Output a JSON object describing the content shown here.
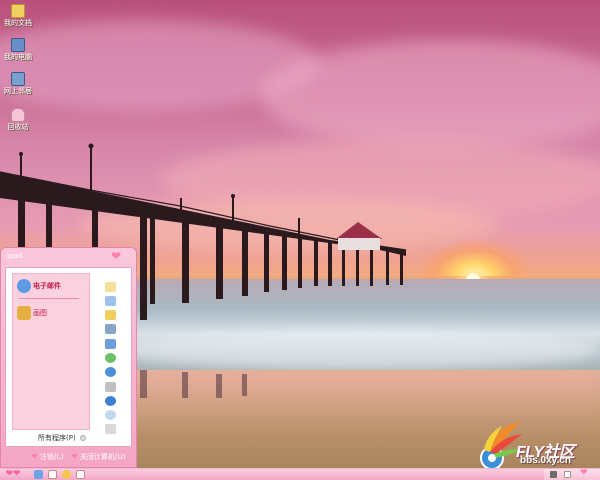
{
  "desktop_icons": [
    {
      "label": "我的文档",
      "icon": "folder-icon",
      "color": "#f0d060"
    },
    {
      "label": "我的电脑",
      "icon": "computer-icon",
      "color": "#6a8fc8"
    },
    {
      "label": "网上邻居",
      "icon": "network-icon",
      "color": "#7aa0d0"
    },
    {
      "label": "回收站",
      "icon": "recycle-bin-icon",
      "color": "#f6c6d6"
    }
  ],
  "start_menu": {
    "user": "ipad",
    "items": [
      {
        "label": "电子邮件",
        "icon": "mail-icon",
        "color": "#5c9be0",
        "bold": true
      },
      {
        "label": "画图",
        "icon": "paint-icon",
        "color": "#e5b040",
        "bold": false
      }
    ],
    "all_programs": "所有程序(P)",
    "right_icons": [
      {
        "icon": "documents-icon",
        "color": "#f4e09a"
      },
      {
        "icon": "recent-documents-icon",
        "color": "#9ec2ee"
      },
      {
        "icon": "folder-icon",
        "color": "#f1cf5e"
      },
      {
        "icon": "computer-icon",
        "color": "#86a5c9"
      },
      {
        "icon": "control-panel-icon",
        "color": "#6f9edc"
      },
      {
        "icon": "network-icon",
        "color": "#6fbf6a"
      },
      {
        "icon": "internet-icon",
        "color": "#4c8fd8"
      },
      {
        "icon": "printer-icon",
        "color": "#c0c0c0"
      },
      {
        "icon": "help-icon",
        "color": "#3f7fd0"
      },
      {
        "icon": "search-icon",
        "color": "#c0d8f0"
      },
      {
        "icon": "run-icon",
        "color": "#d9d9d9"
      }
    ],
    "logoff": "注销(L)",
    "shutdown": "关闭计算机(U)"
  },
  "taskbar": {
    "start": "❤❤",
    "quicklaunch": [
      {
        "icon": "ie-icon",
        "color": "#6fa5e6"
      },
      {
        "icon": "show-desktop-icon",
        "color": "#ffffff"
      },
      {
        "icon": "media-player-icon",
        "color": "#f4c84a"
      },
      {
        "icon": "explorer-icon",
        "color": "#ffffff"
      }
    ],
    "tray_icons": [
      {
        "icon": "network-tray-icon",
        "color": "#6c6c6c"
      },
      {
        "icon": "volume-tray-icon",
        "color": "#ffffff"
      }
    ]
  },
  "watermark": {
    "text": "FLY社区",
    "url": "bbs.0xy.cn"
  }
}
